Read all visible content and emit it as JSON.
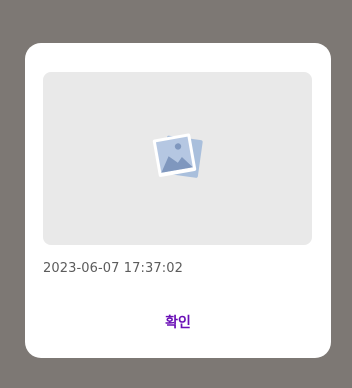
{
  "dialog": {
    "timestamp": "2023-06-07 17:37:02",
    "confirm_label": "확인",
    "image_icon": "image-placeholder-icon"
  },
  "colors": {
    "backdrop": "#7d7874",
    "dialog_bg": "#ffffff",
    "placeholder_bg": "#e9e9e9",
    "accent": "#6a0fb6",
    "text": "#5c5c5c"
  }
}
